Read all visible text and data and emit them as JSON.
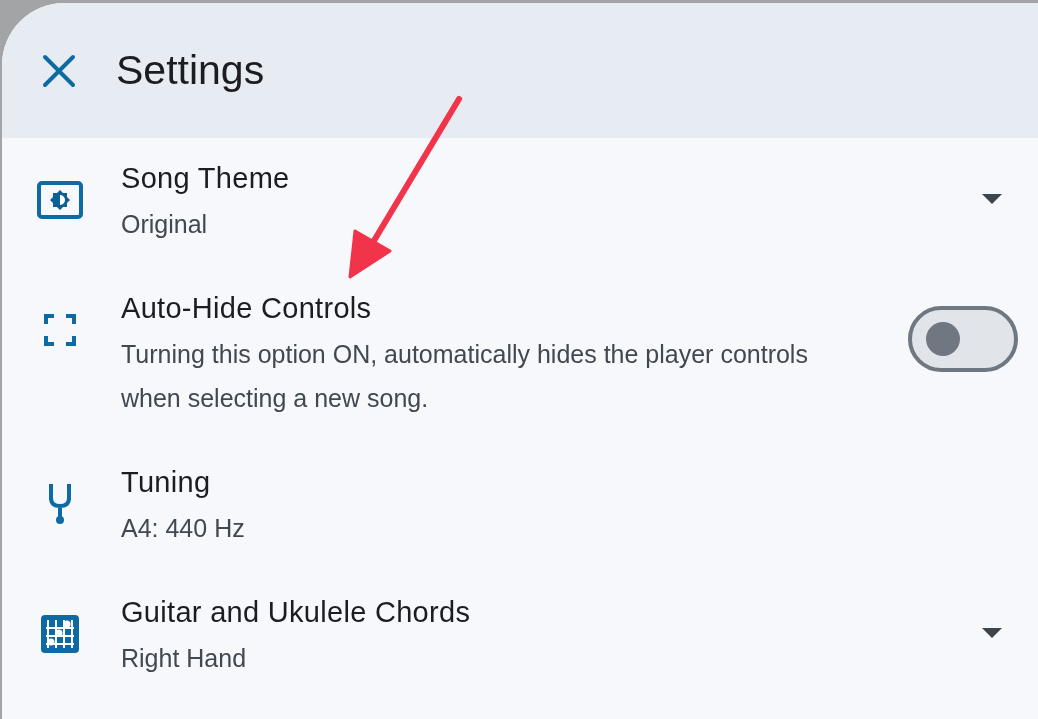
{
  "header": {
    "title": "Settings"
  },
  "items": [
    {
      "kind": "dropdown",
      "title": "Song Theme",
      "subtitle": "Original"
    },
    {
      "kind": "toggle",
      "title": "Auto-Hide Controls",
      "subtitle": "Turning this option ON, automatically hides the player controls when selecting a new song.",
      "on": false
    },
    {
      "kind": "plain",
      "title": "Tuning",
      "subtitle": "A4: 440 Hz"
    },
    {
      "kind": "dropdown",
      "title": "Guitar and Ukulele Chords",
      "subtitle": "Right Hand"
    }
  ]
}
